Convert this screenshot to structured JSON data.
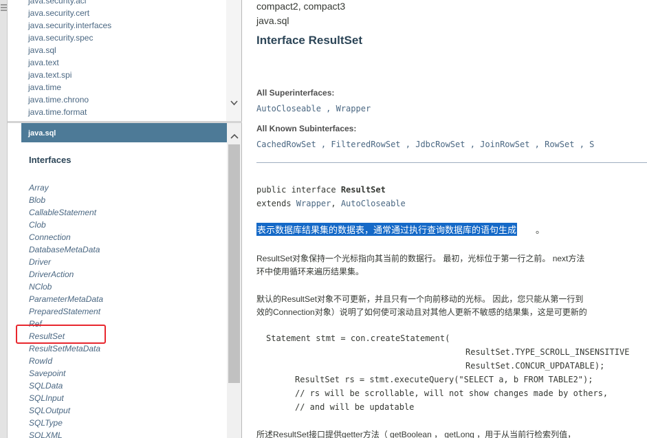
{
  "package_list": [
    "java.security.acl",
    "java.security.cert",
    "java.security.interfaces",
    "java.security.spec",
    "java.sql",
    "java.text",
    "java.text.spi",
    "java.time",
    "java.time.chrono",
    "java.time.format"
  ],
  "class_frame": {
    "header": "java.sql",
    "interfaces_title": "Interfaces",
    "interfaces": [
      "Array",
      "Blob",
      "CallableStatement",
      "Clob",
      "Connection",
      "DatabaseMetaData",
      "Driver",
      "DriverAction",
      "NClob",
      "ParameterMetaData",
      "PreparedStatement",
      "Ref",
      "ResultSet",
      "ResultSetMetaData",
      "RowId",
      "Savepoint",
      "SQLData",
      "SQLInput",
      "SQLOutput",
      "SQLType",
      "SQLXML"
    ],
    "highlighted_interface": "ResultSet",
    "highlight_color": "#e8262d"
  },
  "content": {
    "profiles": "compact2, compact3",
    "package": "java.sql",
    "title": "Interface ResultSet",
    "superinterfaces_label": "All Superinterfaces:",
    "superinterfaces": [
      "AutoCloseable",
      "Wrapper"
    ],
    "subinterfaces_label": "All Known Subinterfaces:",
    "subinterfaces": [
      "CachedRowSet",
      "FilteredRowSet",
      "JdbcRowSet",
      "JoinRowSet",
      "RowSet",
      "S"
    ],
    "decl": {
      "line1_prefix": "public interface ",
      "line1_name": "ResultSet",
      "line2_prefix": "extends ",
      "line2_wrapper": "Wrapper",
      "line2_sep": ", ",
      "line2_auto": "AutoCloseable"
    },
    "description_selected": "表示数据库结果集的数据表，通常通过执行查询数据库的语句生成",
    "description_period": "。",
    "para1_line1": "ResultSet对象保持一个光标指向其当前的数据行。 最初，光标位于第一行之前。 next方法",
    "para1_line2": "环中使用循环来遍历结果集。",
    "para2_line1": "默认的ResultSet对象不可更新，并且只有一个向前移动的光标。 因此，您只能从第一行到",
    "para2_line2": "效的Connection对象）说明了如何使可滚动且对其他人更新不敏感的结果集，这是可更新的",
    "code": [
      "Statement stmt = con.createStatement(",
      "ResultSet.TYPE_SCROLL_INSENSITIVE",
      "ResultSet.CONCUR_UPDATABLE);",
      "ResultSet rs = stmt.executeQuery(\"SELECT a, b FROM TABLE2\");",
      "// rs will be scrollable, will not show changes made by others,",
      "// and will be updatable"
    ],
    "para3_line1": "所述ResultSet接口提供getter方法（ getBoolean ， getLong ，用于从当前行检索列值，"
  }
}
